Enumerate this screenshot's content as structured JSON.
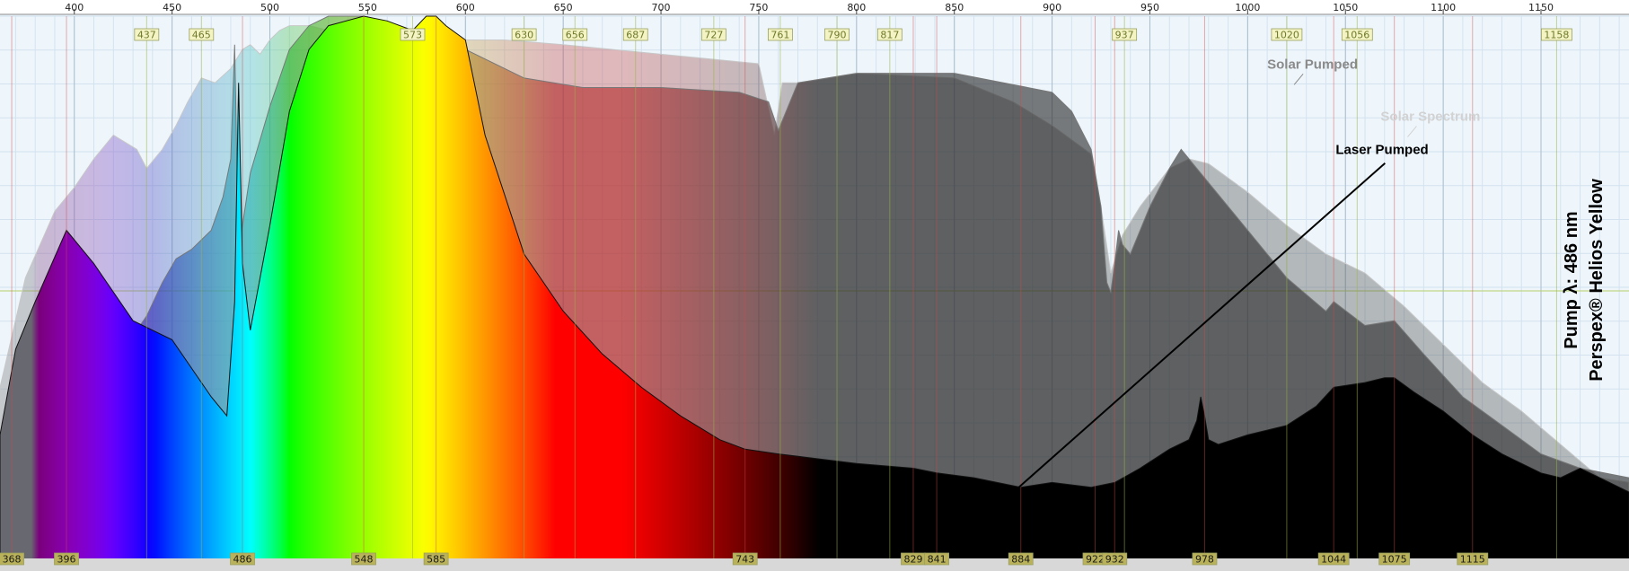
{
  "chart_data": {
    "type": "area",
    "title": "",
    "xlabel": "",
    "ylabel": "",
    "xlim": [
      362,
      1195
    ],
    "ylim": [
      0,
      1
    ],
    "grid": true,
    "x_ticks": [
      400,
      450,
      500,
      550,
      600,
      650,
      700,
      750,
      800,
      850,
      900,
      950,
      1000,
      1050,
      1100,
      1150
    ],
    "top_peak_labels": [
      "437",
      "465",
      "573",
      "630",
      "656",
      "687",
      "727",
      "761",
      "790",
      "817",
      "937",
      "1020",
      "1056",
      "1158"
    ],
    "bottom_peak_labels": [
      "368",
      "396",
      "486",
      "548",
      "585",
      "743",
      "829",
      "841",
      "884",
      "922",
      "932",
      "978",
      "1044",
      "1075",
      "1115"
    ],
    "side_text": [
      "Pump λ: 486 nm",
      "Perspex® Helios Yellow"
    ],
    "series": [
      {
        "name": "Solar Spectrum",
        "x": [
          362,
          375,
          390,
          400,
          410,
          420,
          432,
          437,
          445,
          452,
          458,
          465,
          472,
          480,
          486,
          490,
          495,
          500,
          505,
          510,
          515,
          520,
          530,
          540,
          548,
          555,
          565,
          573,
          585,
          600,
          620,
          650,
          700,
          750,
          758,
          762,
          770,
          800,
          850,
          880,
          900,
          920,
          925,
          930,
          936,
          945,
          960,
          970,
          980,
          1000,
          1020,
          1040,
          1060,
          1080,
          1100,
          1120,
          1140,
          1160,
          1180,
          1195
        ],
        "y": [
          0.22,
          0.45,
          0.59,
          0.64,
          0.7,
          0.75,
          0.72,
          0.68,
          0.72,
          0.77,
          0.82,
          0.87,
          0.86,
          0.89,
          0.93,
          0.94,
          0.92,
          0.95,
          0.97,
          0.98,
          0.98,
          0.98,
          0.97,
          0.97,
          0.96,
          0.95,
          0.95,
          0.96,
          0.96,
          0.95,
          0.95,
          0.94,
          0.92,
          0.9,
          0.75,
          0.86,
          0.86,
          0.88,
          0.87,
          0.82,
          0.77,
          0.71,
          0.6,
          0.46,
          0.54,
          0.6,
          0.68,
          0.7,
          0.69,
          0.63,
          0.56,
          0.5,
          0.46,
          0.39,
          0.31,
          0.23,
          0.17,
          0.1,
          0.03,
          0.02
        ]
      },
      {
        "name": "Solar Pumped",
        "x": [
          362,
          372,
          380,
          390,
          398,
          405,
          415,
          425,
          432,
          437,
          445,
          452,
          460,
          470,
          476,
          480,
          482,
          484,
          486,
          490,
          500,
          510,
          520,
          530,
          540,
          548,
          555,
          565,
          573,
          585,
          600,
          630,
          660,
          700,
          740,
          755,
          760,
          770,
          800,
          850,
          900,
          910,
          920,
          925,
          928,
          930,
          932,
          934,
          936,
          940,
          950,
          960,
          966,
          970,
          980,
          1000,
          1020,
          1040,
          1044,
          1060,
          1075,
          1090,
          1110,
          1130,
          1150,
          1170,
          1195
        ],
        "y": [
          0.02,
          0.2,
          0.32,
          0.42,
          0.48,
          0.46,
          0.39,
          0.35,
          0.34,
          0.37,
          0.44,
          0.49,
          0.51,
          0.55,
          0.62,
          0.7,
          0.94,
          0.5,
          0.56,
          0.67,
          0.81,
          0.93,
          0.98,
          1.0,
          1.0,
          1.0,
          0.99,
          0.96,
          0.92,
          0.98,
          0.93,
          0.87,
          0.85,
          0.85,
          0.84,
          0.82,
          0.76,
          0.86,
          0.88,
          0.88,
          0.84,
          0.8,
          0.72,
          0.6,
          0.44,
          0.42,
          0.48,
          0.55,
          0.52,
          0.5,
          0.6,
          0.68,
          0.72,
          0.7,
          0.65,
          0.55,
          0.45,
          0.38,
          0.4,
          0.35,
          0.36,
          0.29,
          0.2,
          0.14,
          0.08,
          0.05,
          0.03
        ]
      },
      {
        "name": "Laser Pumped",
        "x": [
          362,
          370,
          380,
          396,
          410,
          430,
          450,
          470,
          478,
          482,
          484,
          486,
          490,
          500,
          510,
          520,
          530,
          548,
          560,
          573,
          580,
          585,
          590,
          600,
          610,
          630,
          650,
          670,
          690,
          710,
          730,
          743,
          760,
          800,
          829,
          841,
          860,
          884,
          900,
          920,
          932,
          945,
          960,
          970,
          974,
          976,
          978,
          980,
          985,
          1000,
          1020,
          1035,
          1044,
          1060,
          1070,
          1075,
          1085,
          1100,
          1115,
          1130,
          1150,
          1160,
          1170,
          1195
        ],
        "y": [
          0.12,
          0.3,
          0.4,
          0.55,
          0.48,
          0.36,
          0.32,
          0.2,
          0.16,
          0.4,
          0.86,
          0.48,
          0.34,
          0.56,
          0.8,
          0.93,
          0.98,
          1.0,
          0.99,
          0.97,
          1.0,
          1.0,
          0.98,
          0.95,
          0.75,
          0.5,
          0.38,
          0.29,
          0.22,
          0.16,
          0.11,
          0.09,
          0.08,
          0.06,
          0.05,
          0.04,
          0.03,
          0.01,
          0.02,
          0.01,
          0.02,
          0.05,
          0.09,
          0.11,
          0.15,
          0.2,
          0.16,
          0.11,
          0.1,
          0.12,
          0.14,
          0.18,
          0.22,
          0.23,
          0.24,
          0.24,
          0.21,
          0.17,
          0.12,
          0.08,
          0.04,
          0.03,
          0.05,
          0.0
        ]
      }
    ],
    "annotations": [
      {
        "text": "Solar Pumped",
        "x": 1010,
        "y": 0.89
      },
      {
        "text": "Solar Spectrum",
        "x": 1068,
        "y": 0.78
      },
      {
        "text": "Laser Pumped",
        "x": 1045,
        "y": 0.71,
        "arrow_to": [
          883,
          0.01
        ]
      }
    ]
  }
}
